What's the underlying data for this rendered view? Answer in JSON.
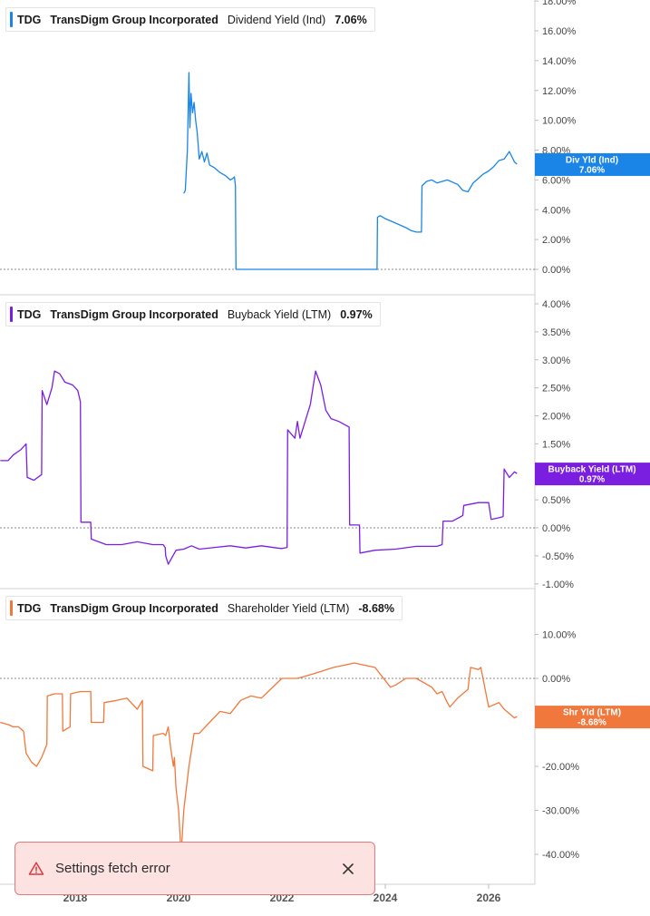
{
  "chart_data": [
    {
      "type": "line",
      "ticker": "TDG",
      "company": "TransDigm Group Incorporated",
      "metric": "Dividend Yield (Ind)",
      "current_value": "7.06%",
      "tag_label": "Div Yld (Ind)",
      "tag_value": "7.06%",
      "color": "#1a85e6",
      "y_ticks": [
        "18.00%",
        "16.00%",
        "14.00%",
        "12.00%",
        "10.00%",
        "8.00%",
        "6.00%",
        "4.00%",
        "2.00%",
        "0.00%"
      ],
      "ylim": [
        0,
        18
      ],
      "x_ticks": [
        "2018",
        "2020",
        "2022",
        "2024",
        "2026"
      ],
      "x": [
        2020.1,
        2020.13,
        2020.17,
        2020.2,
        2020.22,
        2020.24,
        2020.27,
        2020.3,
        2020.33,
        2020.36,
        2020.4,
        2020.45,
        2020.5,
        2020.55,
        2020.6,
        2020.7,
        2020.8,
        2020.9,
        2021.0,
        2021.05,
        2021.08,
        2021.1,
        2021.11,
        2022.0,
        2023.0,
        2023.84,
        2023.85,
        2023.9,
        2024.0,
        2024.2,
        2024.4,
        2024.5,
        2024.6,
        2024.7,
        2024.71,
        2024.8,
        2024.9,
        2025.0,
        2025.2,
        2025.4,
        2025.5,
        2025.6,
        2025.7,
        2025.8,
        2025.9,
        2026.0,
        2026.1,
        2026.2,
        2026.3,
        2026.4,
        2026.5,
        2026.55
      ],
      "y": [
        5.1,
        5.3,
        8.0,
        13.2,
        9.5,
        11.8,
        10.5,
        11.2,
        10.0,
        9.2,
        7.4,
        7.9,
        7.2,
        7.8,
        7.0,
        6.8,
        6.5,
        6.3,
        6.0,
        6.1,
        6.2,
        5.6,
        0.0,
        0.0,
        0.0,
        0.0,
        3.5,
        3.6,
        3.4,
        3.1,
        2.8,
        2.6,
        2.5,
        2.5,
        5.6,
        5.9,
        6.0,
        5.8,
        6.0,
        5.7,
        5.3,
        5.2,
        5.8,
        6.1,
        6.4,
        6.6,
        6.9,
        7.3,
        7.4,
        7.9,
        7.2,
        7.06
      ]
    },
    {
      "type": "line",
      "ticker": "TDG",
      "company": "TransDigm Group Incorporated",
      "metric": "Buyback Yield (LTM)",
      "current_value": "0.97%",
      "tag_label": "Buyback Yield (LTM)",
      "tag_value": "0.97%",
      "color": "#7a1fe0",
      "y_ticks": [
        "4.00%",
        "3.50%",
        "3.00%",
        "2.50%",
        "2.00%",
        "1.50%",
        "1.00%",
        "0.50%",
        "0.00%",
        "-0.50%",
        "-1.00%"
      ],
      "ylim": [
        -1.0,
        4.0
      ],
      "x_ticks": [
        "2018",
        "2020",
        "2022",
        "2024",
        "2026"
      ],
      "x": [
        2016.55,
        2016.7,
        2016.8,
        2016.95,
        2017.0,
        2017.05,
        2017.07,
        2017.2,
        2017.35,
        2017.36,
        2017.45,
        2017.55,
        2017.6,
        2017.7,
        2017.8,
        2017.95,
        2018.05,
        2018.1,
        2018.11,
        2018.3,
        2018.31,
        2018.6,
        2018.9,
        2019.2,
        2019.5,
        2019.7,
        2019.74,
        2019.75,
        2019.8,
        2019.95,
        2020.1,
        2020.25,
        2020.4,
        2020.7,
        2021.0,
        2021.3,
        2021.6,
        2021.9,
        2022.0,
        2022.1,
        2022.11,
        2022.25,
        2022.3,
        2022.35,
        2022.55,
        2022.65,
        2022.75,
        2022.85,
        2022.95,
        2023.1,
        2023.2,
        2023.3,
        2023.31,
        2023.5,
        2023.51,
        2023.8,
        2024.2,
        2024.6,
        2024.8,
        2025.0,
        2025.1,
        2025.12,
        2025.3,
        2025.5,
        2025.52,
        2025.8,
        2026.0,
        2026.05,
        2026.2,
        2026.28,
        2026.3,
        2026.4,
        2026.5,
        2026.55
      ],
      "y": [
        1.2,
        1.2,
        1.3,
        1.4,
        1.45,
        1.5,
        0.9,
        0.85,
        0.95,
        2.45,
        2.2,
        2.5,
        2.8,
        2.75,
        2.6,
        2.55,
        2.45,
        2.25,
        0.1,
        0.1,
        -0.2,
        -0.3,
        -0.3,
        -0.25,
        -0.3,
        -0.3,
        -0.35,
        -0.5,
        -0.65,
        -0.4,
        -0.38,
        -0.32,
        -0.38,
        -0.35,
        -0.32,
        -0.36,
        -0.32,
        -0.36,
        -0.37,
        -0.35,
        1.75,
        1.6,
        1.9,
        1.6,
        2.2,
        2.8,
        2.55,
        2.1,
        1.95,
        1.9,
        1.85,
        1.8,
        0.05,
        0.05,
        -0.45,
        -0.4,
        -0.38,
        -0.33,
        -0.33,
        -0.33,
        -0.3,
        0.12,
        0.12,
        0.22,
        0.4,
        0.45,
        0.45,
        0.15,
        0.18,
        0.2,
        1.05,
        0.9,
        1.0,
        0.97
      ]
    },
    {
      "type": "line",
      "ticker": "TDG",
      "company": "TransDigm Group Incorporated",
      "metric": "Shareholder Yield (LTM)",
      "current_value": "-8.68%",
      "tag_label": "Shr Yld (LTM)",
      "tag_value": "-8.68%",
      "color": "#f0783c",
      "y_ticks": [
        "10.00%",
        "0.00%",
        "-10.00%",
        "-20.00%",
        "-30.00%",
        "-40.00%"
      ],
      "ylim": [
        -45,
        15
      ],
      "x_ticks": [
        "2018",
        "2020",
        "2022",
        "2024",
        "2026"
      ],
      "x": [
        2016.55,
        2016.7,
        2016.8,
        2016.9,
        2017.0,
        2017.05,
        2017.15,
        2017.25,
        2017.35,
        2017.45,
        2017.46,
        2017.6,
        2017.75,
        2017.76,
        2017.9,
        2017.91,
        2018.1,
        2018.3,
        2018.31,
        2018.55,
        2018.56,
        2018.8,
        2019.0,
        2019.2,
        2019.3,
        2019.31,
        2019.5,
        2019.51,
        2019.7,
        2019.75,
        2019.8,
        2019.85,
        2019.9,
        2019.92,
        2019.95,
        2020.0,
        2020.05,
        2020.1,
        2020.2,
        2020.3,
        2020.4,
        2020.6,
        2020.8,
        2021.0,
        2021.2,
        2021.3,
        2021.4,
        2021.6,
        2022.0,
        2022.3,
        2022.6,
        2023.0,
        2023.2,
        2023.4,
        2023.6,
        2023.8,
        2024.1,
        2024.2,
        2024.4,
        2024.6,
        2024.9,
        2025.0,
        2025.1,
        2025.2,
        2025.25,
        2025.4,
        2025.6,
        2025.65,
        2025.8,
        2025.85,
        2026.0,
        2026.2,
        2026.3,
        2026.4,
        2026.5,
        2026.55
      ],
      "y": [
        -10.0,
        -10.5,
        -11.0,
        -11.0,
        -12.0,
        -17.0,
        -19.0,
        -20.0,
        -18.0,
        -15.0,
        -4.0,
        -3.5,
        -3.5,
        -12.0,
        -11.0,
        -3.5,
        -3.0,
        -3.0,
        -10.0,
        -10.0,
        -5.5,
        -5.0,
        -4.5,
        -7.0,
        -5.0,
        -20.0,
        -21.0,
        -13.0,
        -12.5,
        -13.0,
        -11.0,
        -16.0,
        -20.0,
        -18.0,
        -25.0,
        -30.0,
        -40.0,
        -30.0,
        -20.0,
        -12.5,
        -12.5,
        -10.0,
        -7.5,
        -8.0,
        -5.0,
        -4.5,
        -4.0,
        -4.5,
        0.0,
        0.0,
        1.0,
        2.5,
        3.0,
        3.5,
        3.0,
        2.5,
        -2.0,
        -1.5,
        0.0,
        0.0,
        -2.0,
        -3.5,
        -3.0,
        -5.5,
        -6.5,
        -4.5,
        -2.5,
        2.5,
        2.0,
        2.5,
        -6.5,
        -5.5,
        -7.0,
        -8.0,
        -9.0,
        -8.68
      ]
    }
  ],
  "toast": {
    "message": "Settings fetch error",
    "icon": "warning-triangle-icon",
    "close_icon": "close-icon"
  }
}
